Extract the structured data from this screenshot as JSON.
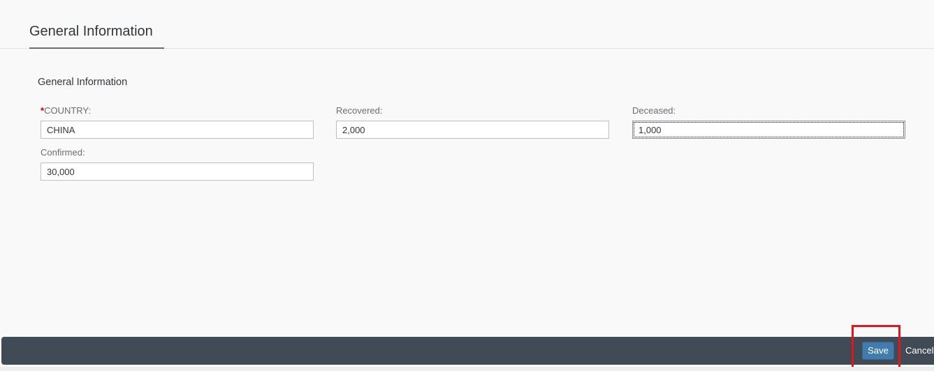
{
  "tabs": {
    "active_label": "General Information"
  },
  "section": {
    "title": "General Information"
  },
  "fields": {
    "country": {
      "required_marker": "*",
      "label": "COUNTRY:",
      "value": "CHINA"
    },
    "recovered": {
      "label": "Recovered:",
      "value": "2,000"
    },
    "deceased": {
      "label": "Deceased:",
      "value": "1,000"
    },
    "confirmed": {
      "label": "Confirmed:",
      "value": "30,000"
    }
  },
  "footer": {
    "save_label": "Save",
    "cancel_label": "Cancel"
  },
  "colors": {
    "footer_bg": "#414b55",
    "primary_button": "#427cac",
    "highlight": "#e0161e",
    "required": "#bb0000"
  }
}
